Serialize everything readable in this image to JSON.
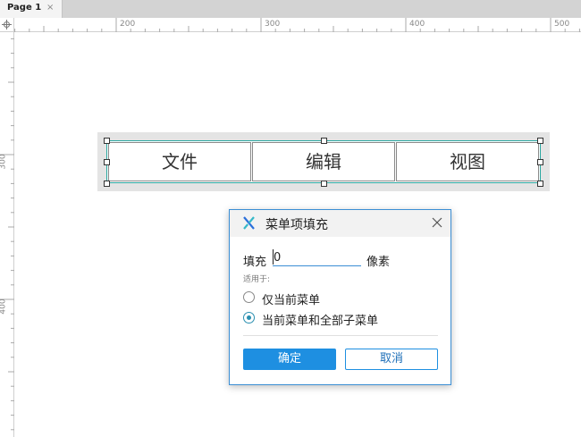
{
  "tabs": [
    {
      "label": "Page 1",
      "close": "×"
    }
  ],
  "ruler": {
    "horizontal_labels": [
      "200",
      "300",
      "400",
      "500"
    ],
    "vertical_labels": [
      "300",
      "400"
    ]
  },
  "menu": {
    "items": [
      "文件",
      "编辑",
      "视图"
    ],
    "accent_color": "#2aa8a1"
  },
  "dialog": {
    "title": "菜单项填充",
    "close_icon": "close-icon",
    "fill_label": "填充",
    "fill_value": "0",
    "unit_label": "像素",
    "apply_label": "适用于:",
    "options": [
      {
        "label": "仅当前菜单",
        "checked": false
      },
      {
        "label": "当前菜单和全部子菜单",
        "checked": true
      }
    ],
    "ok_label": "确定",
    "cancel_label": "取消",
    "accent_color": "#1e8fe1"
  }
}
